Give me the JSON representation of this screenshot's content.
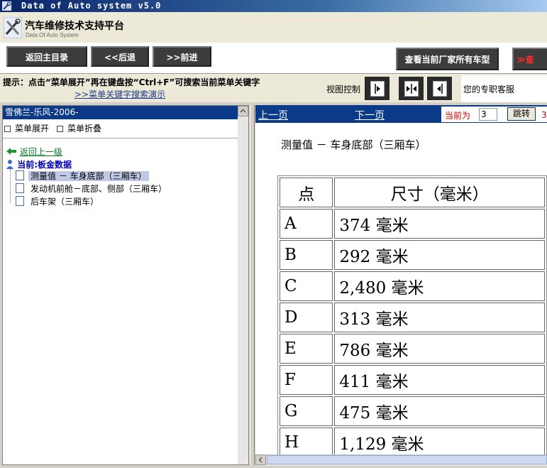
{
  "window": {
    "title": "Data of Auto system v5.0"
  },
  "header": {
    "app_title": "汽车维修技术支持平台",
    "app_subtitle": "Data Of Auto System"
  },
  "toolbar": {
    "home_label": "返回主目录",
    "back_label": "<<后退",
    "forward_label": ">>前进",
    "makers_label": "查看当前厂家所有车型",
    "search_label": "≫查"
  },
  "hint": {
    "text": "提示：点击“菜单展开”再在键盘按“Ctrl+F”可搜索当前菜单关键字",
    "link": ">>菜单关键字搜索演示"
  },
  "view_control": {
    "label": "视图控制"
  },
  "service": {
    "label": "您的专职客服"
  },
  "left_panel": {
    "header": "雪佛兰-乐风-2006-",
    "expand_label": "菜单展开",
    "collapse_label": "菜单折叠",
    "back_label": "返回上一级",
    "current_label": "当前:板金数据",
    "items": [
      {
        "label": "测量值 － 车身底部（三厢车）",
        "selected": true
      },
      {
        "label": "发动机前舱－底部、侧部（三厢车）",
        "selected": false
      },
      {
        "label": "后车架（三厢车）",
        "selected": false
      }
    ]
  },
  "nav": {
    "prev_label": "上一页",
    "next_label": "下一页",
    "current_label": "当前为",
    "page_value": "3",
    "jump_label": "跳转",
    "total": "3"
  },
  "document": {
    "title": "测量值 － 车身底部（三厢车）",
    "table": {
      "headers": [
        "点",
        "尺寸（毫米）"
      ],
      "rows": [
        [
          "A",
          "374 毫米"
        ],
        [
          "B",
          "292 毫米"
        ],
        [
          "C",
          "2,480 毫米"
        ],
        [
          "D",
          "313 毫米"
        ],
        [
          "E",
          "786 毫米"
        ],
        [
          "F",
          "411 毫米"
        ],
        [
          "G",
          "475 毫米"
        ],
        [
          "H",
          "1,129 毫米"
        ]
      ]
    }
  },
  "colors": {
    "title_bar": "#0a246a",
    "panel_head": "#0a3a88",
    "link_green": "#0a7a2a",
    "accent_red": "#cc0000"
  }
}
